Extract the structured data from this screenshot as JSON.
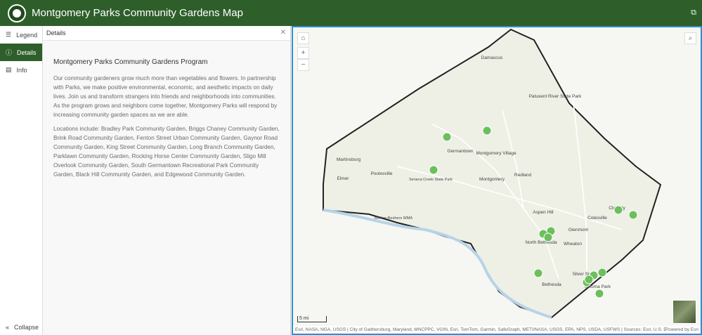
{
  "header": {
    "title": "Montgomery Parks Community Gardens Map"
  },
  "nav": {
    "items": [
      {
        "label": "Legend"
      },
      {
        "label": "Details"
      },
      {
        "label": "Info"
      }
    ],
    "collapse": "Collapse"
  },
  "panel": {
    "title": "Details",
    "heading": "Montgomery Parks Community Gardens Program",
    "p1": "Our community gardeners grow much more than vegetables and flowers. In partnership with Parks, we make positive environmental, economic, and aesthetic impacts on daily lives. Join us and transform strangers into friends and neighborhoods into communities. As the program grows and neighbors come together, Montgomery Parks will respond by increasing community garden spaces as we are able.",
    "p2": "Locations include: Bradley Park Community Garden, Briggs Chaney Community Garden, Brink Road Community Garden, Fenton Street Urban Community Garden, Gaynor Road Community Garden, King Street Community Garden, Long Branch Community Garden, Parklawn Community Garden, Rocking Horse Center Community Garden, Sligo Mill Overlook Community Garden, South Germantown Recreational Park Community Garden, Black Hill Community Garden, and Edgewood Community Garden."
  },
  "map": {
    "scale": "5 mi",
    "attribution": "Esri, NASA, NGA, USGS | City of Gaithersburg, Maryland, MNCPPC, VGIN, Esri, TomTom, Garmin, SafeGraph, METI/NASA, USGS, EPA, NPS, USDA, USFWS | Sources: Esri, U.S. Department...",
    "powered": "Powered by Esri",
    "labels": [
      "Damascus",
      "Germantown",
      "Montgomery Village",
      "Redland",
      "Montgomery",
      "Martinsburg",
      "Poolesville",
      "Elmer",
      "Seneca Creek State Park",
      "McKee-Beshers WMA",
      "Aspen Hill",
      "Colesville",
      "Cloverly",
      "Glenmont",
      "North Bethesda",
      "Wheaton",
      "Silver Spring",
      "Bethesda",
      "Takoma Park",
      "Patuxent River State Park"
    ],
    "marker_color": "#6cbf5c"
  }
}
